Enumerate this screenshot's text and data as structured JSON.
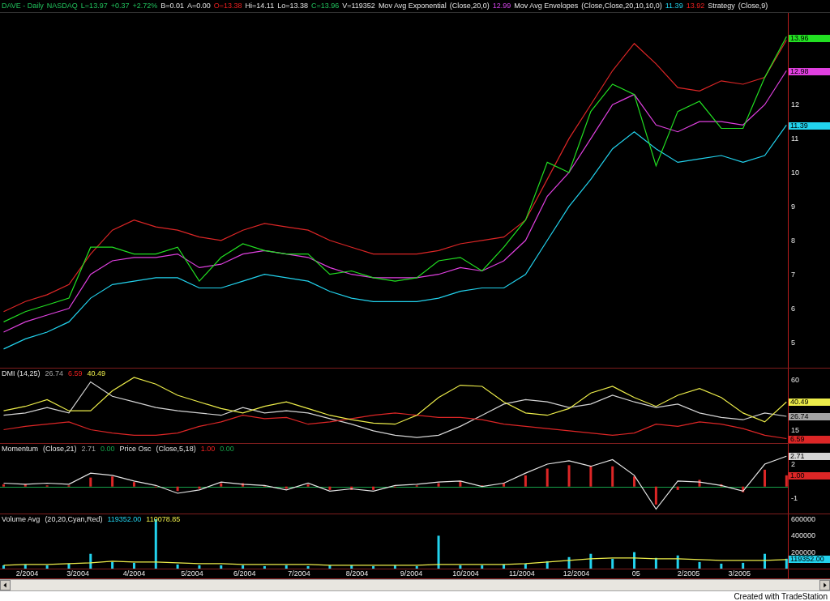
{
  "header": [
    {
      "text": "DAVE - Daily",
      "kind": "up"
    },
    {
      "text": "NASDAQ",
      "kind": "up"
    },
    {
      "text": "L=13.97",
      "kind": "up"
    },
    {
      "text": "+0.37",
      "kind": "up"
    },
    {
      "text": "+2.72%",
      "kind": "up"
    },
    {
      "text": "B=0.01",
      "kind": "plain"
    },
    {
      "text": "A=0.00",
      "kind": "plain"
    },
    {
      "text": "O=13.38",
      "kind": "down"
    },
    {
      "text": "Hi=14.11",
      "kind": "plain"
    },
    {
      "text": "Lo=13.38",
      "kind": "plain"
    },
    {
      "text": "C=13.96",
      "kind": "up"
    },
    {
      "text": "V=119352",
      "kind": "plain"
    },
    {
      "text": "Mov Avg Exponential",
      "kind": "plain"
    },
    {
      "text": "(Close,20,0)",
      "kind": "plain"
    },
    {
      "text": "12.99",
      "kind": "magenta"
    },
    {
      "text": "Mov Avg Envelopes",
      "kind": "plain"
    },
    {
      "text": "(Close,Close,20,10,10,0)",
      "kind": "plain"
    },
    {
      "text": "11.39",
      "kind": "cyan"
    },
    {
      "text": "13.92",
      "kind": "down"
    },
    {
      "text": "Strategy",
      "kind": "plain"
    },
    {
      "text": "(Close,9)",
      "kind": "plain"
    }
  ],
  "panes": [
    {
      "value_tags": [
        {
          "text": "13.96",
          "color": "#22e022"
        },
        {
          "text": "12.98",
          "color": "#e040e0"
        },
        {
          "text": "11.39",
          "color": "#22d3ee"
        }
      ],
      "layers": [
        {
          "chart_data": {
            "type": "line",
            "x": [
              "2004-01-20",
              "2004-02-01",
              "2004-02-13",
              "2004-02-25",
              "2004-03-08",
              "2004-03-20",
              "2004-04-01",
              "2004-04-13",
              "2004-04-25",
              "2004-05-07",
              "2004-05-19",
              "2004-05-31",
              "2004-06-12",
              "2004-06-24",
              "2004-07-06",
              "2004-07-18",
              "2004-07-30",
              "2004-08-11",
              "2004-08-23",
              "2004-09-04",
              "2004-09-16",
              "2004-09-28",
              "2004-10-10",
              "2004-10-22",
              "2004-11-03",
              "2004-11-15",
              "2004-11-27",
              "2004-12-09",
              "2004-12-21",
              "2005-01-02",
              "2005-01-14",
              "2005-01-26",
              "2005-02-07",
              "2005-02-19",
              "2005-03-03",
              "2005-03-15",
              "2005-03-27"
            ],
            "xlim": [
              "2004-01-18",
              "2005-04-20"
            ],
            "ylim": [
              4.25,
              14.7
            ],
            "yticks": [
              5,
              6,
              7,
              8,
              9,
              10,
              11,
              12
            ],
            "series": [
              {
                "color": "#dc2626",
                "values": [
                  5.9,
                  6.2,
                  6.4,
                  6.7,
                  7.6,
                  8.3,
                  8.6,
                  8.4,
                  8.3,
                  8.1,
                  8.0,
                  8.3,
                  8.5,
                  8.4,
                  8.3,
                  8.0,
                  7.8,
                  7.6,
                  7.6,
                  7.6,
                  7.7,
                  7.9,
                  8.0,
                  8.1,
                  8.6,
                  9.8,
                  11.0,
                  12.0,
                  13.0,
                  13.8,
                  13.2,
                  12.5,
                  12.4,
                  12.7,
                  12.6,
                  12.8,
                  13.9
                ]
              },
              {
                "color": "#22d3ee",
                "values": [
                  4.8,
                  5.1,
                  5.3,
                  5.6,
                  6.3,
                  6.7,
                  6.8,
                  6.9,
                  6.9,
                  6.6,
                  6.6,
                  6.8,
                  7.0,
                  6.9,
                  6.8,
                  6.5,
                  6.3,
                  6.2,
                  6.2,
                  6.2,
                  6.3,
                  6.5,
                  6.6,
                  6.6,
                  7.0,
                  8.0,
                  9.0,
                  9.8,
                  10.7,
                  11.2,
                  10.7,
                  10.3,
                  10.4,
                  10.5,
                  10.3,
                  10.5,
                  11.4
                ]
              },
              {
                "color": "#e040e0",
                "values": [
                  5.3,
                  5.6,
                  5.8,
                  6.0,
                  7.0,
                  7.4,
                  7.5,
                  7.5,
                  7.6,
                  7.2,
                  7.3,
                  7.6,
                  7.7,
                  7.6,
                  7.5,
                  7.2,
                  7.0,
                  6.9,
                  6.9,
                  6.9,
                  7.0,
                  7.2,
                  7.1,
                  7.4,
                  8.0,
                  9.3,
                  10.0,
                  11.0,
                  12.0,
                  12.3,
                  11.4,
                  11.2,
                  11.5,
                  11.5,
                  11.4,
                  12.0,
                  13.0
                ]
              },
              {
                "color": "#22e022",
                "values": [
                  5.6,
                  5.9,
                  6.1,
                  6.3,
                  7.8,
                  7.8,
                  7.6,
                  7.6,
                  7.8,
                  6.8,
                  7.5,
                  7.9,
                  7.7,
                  7.6,
                  7.6,
                  7.0,
                  7.1,
                  6.9,
                  6.8,
                  6.9,
                  7.4,
                  7.5,
                  7.1,
                  7.8,
                  8.6,
                  10.3,
                  10.0,
                  11.8,
                  12.6,
                  12.3,
                  10.2,
                  11.8,
                  12.1,
                  11.3,
                  11.3,
                  12.8,
                  14.0
                ]
              }
            ]
          }
        }
      ]
    },
    {
      "legend": [
        {
          "text": "DMI (14,25)",
          "kind": "plain"
        },
        {
          "text": "26.74",
          "kind": "grey"
        },
        {
          "text": "6.59",
          "kind": "down"
        },
        {
          "text": "40.49",
          "kind": "yellow"
        }
      ],
      "value_tags": [
        {
          "text": "40.49",
          "color": "#eded4a"
        },
        {
          "text": "26.74",
          "color": "#a3a3a3"
        },
        {
          "text": "6.59",
          "color": "#dc2626"
        }
      ],
      "layers": [
        {
          "chart_data": {
            "type": "line",
            "x": [
              "2004-01-20",
              "2004-02-01",
              "2004-02-13",
              "2004-02-25",
              "2004-03-08",
              "2004-03-20",
              "2004-04-01",
              "2004-04-13",
              "2004-04-25",
              "2004-05-07",
              "2004-05-19",
              "2004-05-31",
              "2004-06-12",
              "2004-06-24",
              "2004-07-06",
              "2004-07-18",
              "2004-07-30",
              "2004-08-11",
              "2004-08-23",
              "2004-09-04",
              "2004-09-16",
              "2004-09-28",
              "2004-10-10",
              "2004-10-22",
              "2004-11-03",
              "2004-11-15",
              "2004-11-27",
              "2004-12-09",
              "2004-12-21",
              "2005-01-02",
              "2005-01-14",
              "2005-01-26",
              "2005-02-07",
              "2005-02-19",
              "2005-03-03",
              "2005-03-15",
              "2005-03-27"
            ],
            "xlim": [
              "2004-01-18",
              "2005-04-20"
            ],
            "ylim": [
              3,
              70
            ],
            "yticks": [
              15,
              60
            ],
            "series": [
              {
                "color": "#d4d4d4",
                "values": [
                  28,
                  30,
                  35,
                  30,
                  58,
                  45,
                  40,
                  35,
                  32,
                  30,
                  28,
                  35,
                  30,
                  32,
                  30,
                  25,
                  20,
                  14,
                  10,
                  8,
                  10,
                  18,
                  28,
                  38,
                  42,
                  40,
                  35,
                  38,
                  46,
                  40,
                  35,
                  38,
                  30,
                  26,
                  24,
                  30,
                  27
                ]
              },
              {
                "color": "#dc2626",
                "values": [
                  15,
                  18,
                  20,
                  22,
                  15,
                  12,
                  10,
                  10,
                  12,
                  18,
                  22,
                  28,
                  25,
                  26,
                  20,
                  22,
                  25,
                  28,
                  30,
                  28,
                  26,
                  26,
                  24,
                  20,
                  18,
                  16,
                  14,
                  12,
                  10,
                  12,
                  20,
                  18,
                  22,
                  20,
                  16,
                  10,
                  7
                ]
              },
              {
                "color": "#eded4a",
                "values": [
                  32,
                  36,
                  42,
                  32,
                  32,
                  50,
                  62,
                  56,
                  46,
                  40,
                  34,
                  30,
                  36,
                  40,
                  34,
                  28,
                  24,
                  21,
                  20,
                  28,
                  44,
                  55,
                  54,
                  40,
                  30,
                  28,
                  34,
                  48,
                  54,
                  44,
                  36,
                  46,
                  52,
                  44,
                  30,
                  22,
                  40
                ]
              }
            ]
          }
        }
      ]
    },
    {
      "legend": [
        {
          "text": "Momentum",
          "kind": "plain"
        },
        {
          "text": "(Close,21)",
          "kind": "plain"
        },
        {
          "text": "2.71",
          "kind": "grey"
        },
        {
          "text": "0.00",
          "kind": "green"
        },
        {
          "text": "Price Osc",
          "kind": "plain"
        },
        {
          "text": "(Close,5,18)",
          "kind": "plain"
        },
        {
          "text": "1.00",
          "kind": "down"
        },
        {
          "text": "0.00",
          "kind": "green"
        }
      ],
      "value_tags": [
        {
          "text": "2.71",
          "color": "#d4d4d4"
        },
        {
          "text": "1.00",
          "color": "#dc2626"
        }
      ],
      "layers": [
        {
          "chart_data": {
            "type": "bar",
            "x": [
              "2004-01-20",
              "2004-02-01",
              "2004-02-13",
              "2004-02-25",
              "2004-03-08",
              "2004-03-20",
              "2004-04-01",
              "2004-04-13",
              "2004-04-25",
              "2004-05-07",
              "2004-05-19",
              "2004-05-31",
              "2004-06-12",
              "2004-06-24",
              "2004-07-06",
              "2004-07-18",
              "2004-07-30",
              "2004-08-11",
              "2004-08-23",
              "2004-09-04",
              "2004-09-16",
              "2004-09-28",
              "2004-10-10",
              "2004-10-22",
              "2004-11-03",
              "2004-11-15",
              "2004-11-27",
              "2004-12-09",
              "2004-12-21",
              "2005-01-02",
              "2005-01-14",
              "2005-01-26",
              "2005-02-07",
              "2005-02-19",
              "2005-03-03",
              "2005-03-15",
              "2005-03-27"
            ],
            "xlim": [
              "2004-01-18",
              "2005-04-20"
            ],
            "ylim": [
              -2.4,
              3.8
            ],
            "yticks": [
              -1,
              2
            ],
            "ref_lines": [
              {
                "axis": "y",
                "value": 0,
                "color": "#16a34a"
              }
            ],
            "series": [
              {
                "color": "#dc2626",
                "values": [
                  0.2,
                  0.2,
                  0.1,
                  0.1,
                  0.8,
                  0.9,
                  0.4,
                  0.0,
                  -0.4,
                  -0.2,
                  0.3,
                  0.3,
                  0.1,
                  -0.2,
                  0.2,
                  -0.3,
                  -0.3,
                  -0.3,
                  0.0,
                  0.1,
                  0.3,
                  0.5,
                  0.1,
                  0.3,
                  1.0,
                  1.6,
                  1.9,
                  1.8,
                  1.8,
                  0.9,
                  -1.6,
                  -0.3,
                  0.6,
                  0.2,
                  -0.5,
                  1.5,
                  1.0
                ]
              },
              {
                "type": "line",
                "color": "#e5e5e5",
                "values": [
                  0.3,
                  0.2,
                  0.3,
                  0.2,
                  1.2,
                  1.0,
                  0.5,
                  0.1,
                  -0.6,
                  -0.3,
                  0.4,
                  0.2,
                  0.1,
                  -0.3,
                  0.3,
                  -0.4,
                  -0.2,
                  -0.4,
                  0.1,
                  0.2,
                  0.4,
                  0.5,
                  0.0,
                  0.3,
                  1.2,
                  2.0,
                  2.3,
                  1.8,
                  2.4,
                  1.0,
                  -2.0,
                  0.5,
                  0.4,
                  0.1,
                  -0.4,
                  2.0,
                  2.7
                ]
              }
            ]
          }
        }
      ]
    },
    {
      "legend": [
        {
          "text": "Volume Avg",
          "kind": "plain"
        },
        {
          "text": "(20,20,Cyan,Red)",
          "kind": "plain"
        },
        {
          "text": "119352.00",
          "kind": "cyan"
        },
        {
          "text": "110078.85",
          "kind": "yellow"
        }
      ],
      "value_tags": [
        {
          "text": "119352.00",
          "color": "#22d3ee"
        }
      ],
      "layers": [
        {
          "chart_data": {
            "type": "bar",
            "x": [
              "2004-01-20",
              "2004-02-01",
              "2004-02-13",
              "2004-02-25",
              "2004-03-08",
              "2004-03-20",
              "2004-04-01",
              "2004-04-13",
              "2004-04-25",
              "2004-05-07",
              "2004-05-19",
              "2004-05-31",
              "2004-06-12",
              "2004-06-24",
              "2004-07-06",
              "2004-07-18",
              "2004-07-30",
              "2004-08-11",
              "2004-08-23",
              "2004-09-04",
              "2004-09-16",
              "2004-09-28",
              "2004-10-10",
              "2004-10-22",
              "2004-11-03",
              "2004-11-15",
              "2004-11-27",
              "2004-12-09",
              "2004-12-21",
              "2005-01-02",
              "2005-01-14",
              "2005-01-26",
              "2005-02-07",
              "2005-02-19",
              "2005-03-03",
              "2005-03-15",
              "2005-03-27"
            ],
            "xlim": [
              "2004-01-18",
              "2005-04-20"
            ],
            "ylim": [
              0,
              660000
            ],
            "yticks": [
              {
                "value": 200000,
                "label": "200000"
              },
              {
                "value": 400000,
                "label": "400000"
              },
              {
                "value": 600000,
                "label": "600000"
              }
            ],
            "xticks": [
              {
                "value": "2004-02-02",
                "label": "2/2004"
              },
              {
                "value": "2004-03-01",
                "label": "3/2004"
              },
              {
                "value": "2004-04-01",
                "label": "4/2004"
              },
              {
                "value": "2004-05-03",
                "label": "5/2004"
              },
              {
                "value": "2004-06-01",
                "label": "6/2004"
              },
              {
                "value": "2004-07-01",
                "label": "7/2004"
              },
              {
                "value": "2004-08-02",
                "label": "8/2004"
              },
              {
                "value": "2004-09-01",
                "label": "9/2004"
              },
              {
                "value": "2004-10-01",
                "label": "10/2004"
              },
              {
                "value": "2004-11-01",
                "label": "11/2004"
              },
              {
                "value": "2004-12-01",
                "label": "12/2004"
              },
              {
                "value": "2005-01-03",
                "label": "05"
              },
              {
                "value": "2005-02-01",
                "label": "2/2005"
              },
              {
                "value": "2005-03-01",
                "label": "3/2005"
              }
            ],
            "series": [
              {
                "color": "#22d3ee",
                "values": [
                  40000,
                  50000,
                  40000,
                  60000,
                  180000,
                  80000,
                  70000,
                  600000,
                  50000,
                  40000,
                  40000,
                  40000,
                  30000,
                  40000,
                  30000,
                  40000,
                  40000,
                  30000,
                  40000,
                  30000,
                  400000,
                  40000,
                  40000,
                  50000,
                  60000,
                  90000,
                  140000,
                  180000,
                  120000,
                  200000,
                  130000,
                  160000,
                  80000,
                  60000,
                  70000,
                  180000,
                  120000
                ]
              },
              {
                "type": "line",
                "color": "#eded4a",
                "values": [
                  40000,
                  50000,
                  50000,
                  60000,
                  70000,
                  90000,
                  80000,
                  80000,
                  70000,
                  60000,
                  60000,
                  50000,
                  50000,
                  50000,
                  50000,
                  40000,
                  40000,
                  40000,
                  40000,
                  40000,
                  50000,
                  50000,
                  50000,
                  50000,
                  60000,
                  80000,
                  100000,
                  120000,
                  130000,
                  130000,
                  120000,
                  120000,
                  110000,
                  100000,
                  100000,
                  100000,
                  110000
                ]
              }
            ]
          }
        }
      ]
    }
  ],
  "footer": "Created with TradeStation"
}
